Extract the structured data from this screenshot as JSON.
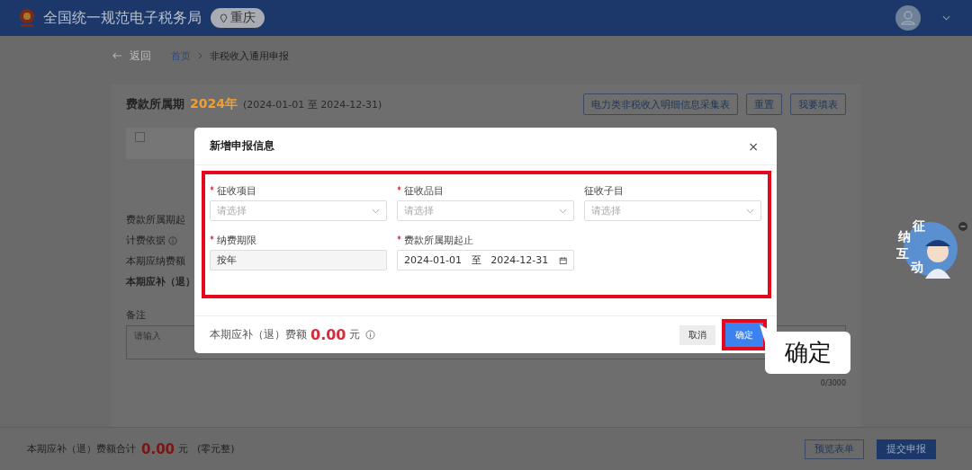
{
  "header": {
    "title": "全国统一规范电子税务局",
    "region": "重庆"
  },
  "breadcrumb": {
    "back": "返回",
    "items": [
      "首页",
      "非税收入通用申报"
    ]
  },
  "period": {
    "label": "费款所属期",
    "year": "2024年",
    "range": "(2024-01-01 至 2024-12-31)"
  },
  "table_header": {
    "checked": false
  },
  "toolbar_buttons": [
    "电力类非税收入明细信息采集表",
    "重置",
    "我要填表"
  ],
  "background_labels": [
    {
      "text": "费款所属期起",
      "info": false,
      "bold": false
    },
    {
      "text": "计费依据",
      "info": true,
      "bold": false
    },
    {
      "text": "本期应纳费额",
      "info": false,
      "bold": false
    },
    {
      "text": "本期应补（退）",
      "info": false,
      "bold": true
    }
  ],
  "remark": {
    "label": "备注",
    "placeholder": "请输入",
    "counter": "0/3000"
  },
  "dialog": {
    "title": "新增申报信息",
    "close": "×",
    "fields": [
      {
        "kind": "select",
        "label": "征收项目",
        "required": true,
        "placeholder": "请选择"
      },
      {
        "kind": "select",
        "label": "征收品目",
        "required": true,
        "placeholder": "请选择"
      },
      {
        "kind": "select",
        "label": "征收子目",
        "required": false,
        "placeholder": "请选择"
      },
      {
        "kind": "text",
        "label": "纳费期限",
        "required": true,
        "value": "按年"
      },
      {
        "kind": "daterange",
        "label": "费款所属期起止",
        "required": true,
        "start": "2024-01-01",
        "separator": "至",
        "end": "2024-12-31"
      }
    ],
    "amount_label": "本期应补（退）费额",
    "amount": "0.00",
    "unit": "元",
    "buttons": [
      "取消",
      "确定"
    ]
  },
  "callout": "确定",
  "mascot": [
    "征",
    "纳",
    "互",
    "动"
  ],
  "footer": {
    "label": "本期应补（退）费额合计",
    "amount": "0.00",
    "unit": "元",
    "words": "(零元整)",
    "buttons": [
      "预览表单",
      "提交申报"
    ]
  }
}
